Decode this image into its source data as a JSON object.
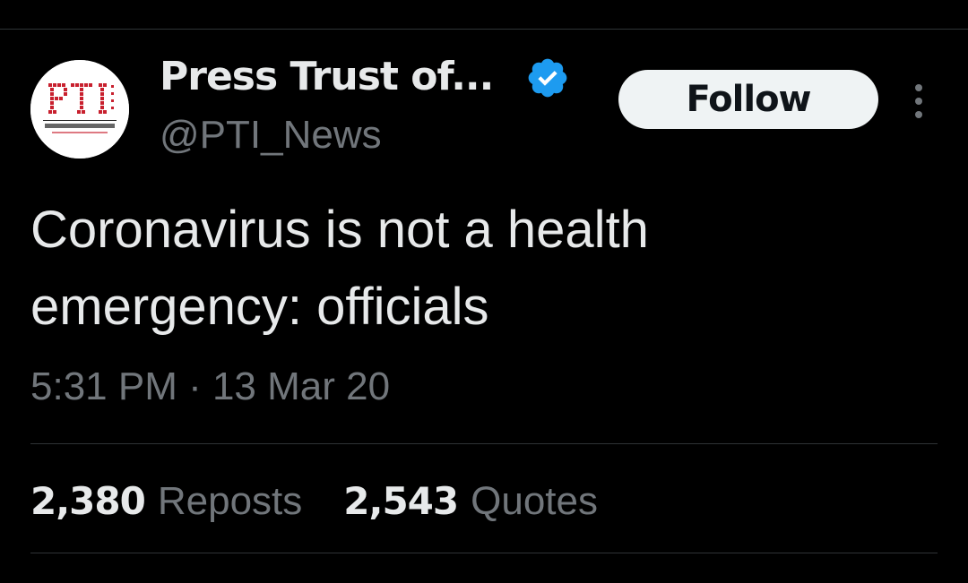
{
  "colors": {
    "background": "#000000",
    "primary_text": "#e7e9ea",
    "secondary_text": "#71767b",
    "divider": "#2f3336",
    "verified_badge": "#1d9bf0",
    "follow_bg": "#eff3f4",
    "follow_text": "#0f1419",
    "logo_red": "#c8202e"
  },
  "author": {
    "avatar_logo_text": "PTI",
    "avatar_caption": "PRESS TRUST OF INDIA",
    "display_name": "Press Trust of...",
    "handle": "@PTI_News",
    "verified_icon": "verified-badge-icon"
  },
  "actions": {
    "follow_label": "Follow",
    "more_icon": "more-vertical-icon"
  },
  "tweet": {
    "text": "Coronavirus is not a health emergency: officials",
    "timestamp": "5:31 PM · 13 Mar 20"
  },
  "stats": {
    "reposts_count": "2,380",
    "reposts_label": "Reposts",
    "quotes_count": "2,543",
    "quotes_label": "Quotes"
  }
}
